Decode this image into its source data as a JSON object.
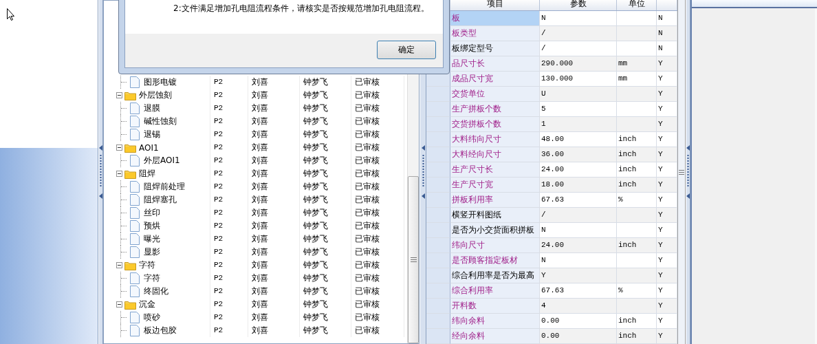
{
  "dialog": {
    "message": "2:文件满足增加孔电阻流程条件，请核实是否按规范增加孔电阻流程。",
    "button": "确定"
  },
  "tree": {
    "nodes": [
      {
        "kind": "file",
        "label": "图形电镀",
        "values": [
          "P2",
          "刘喜",
          "钟梦飞",
          "已审核"
        ]
      },
      {
        "kind": "folder",
        "label": "外层蚀刻",
        "expanded": true,
        "values": [
          "P2",
          "刘喜",
          "钟梦飞",
          "已审核"
        ],
        "children": [
          {
            "kind": "file",
            "label": "退膜",
            "values": [
              "P2",
              "刘喜",
              "钟梦飞",
              "已审核"
            ]
          },
          {
            "kind": "file",
            "label": "碱性蚀刻",
            "values": [
              "P2",
              "刘喜",
              "钟梦飞",
              "已审核"
            ]
          },
          {
            "kind": "file",
            "label": "退锡",
            "values": [
              "P2",
              "刘喜",
              "钟梦飞",
              "已审核"
            ]
          }
        ]
      },
      {
        "kind": "folder",
        "label": "AOI1",
        "expanded": true,
        "values": [
          "P2",
          "刘喜",
          "钟梦飞",
          "已审核"
        ],
        "children": [
          {
            "kind": "file",
            "label": "外层AOI1",
            "values": [
              "P2",
              "刘喜",
              "钟梦飞",
              "已审核"
            ]
          }
        ]
      },
      {
        "kind": "folder",
        "label": "阻焊",
        "expanded": true,
        "values": [
          "P2",
          "刘喜",
          "钟梦飞",
          "已审核"
        ],
        "children": [
          {
            "kind": "file",
            "label": "阻焊前处理",
            "values": [
              "P2",
              "刘喜",
              "钟梦飞",
              "已审核"
            ]
          },
          {
            "kind": "file",
            "label": "阻焊塞孔",
            "values": [
              "P2",
              "刘喜",
              "钟梦飞",
              "已审核"
            ]
          },
          {
            "kind": "file",
            "label": "丝印",
            "values": [
              "P2",
              "刘喜",
              "钟梦飞",
              "已审核"
            ]
          },
          {
            "kind": "file",
            "label": "预烘",
            "values": [
              "P2",
              "刘喜",
              "钟梦飞",
              "已审核"
            ]
          },
          {
            "kind": "file",
            "label": "曝光",
            "values": [
              "P2",
              "刘喜",
              "钟梦飞",
              "已审核"
            ]
          },
          {
            "kind": "file",
            "label": "显影",
            "values": [
              "P2",
              "刘喜",
              "钟梦飞",
              "已审核"
            ]
          }
        ]
      },
      {
        "kind": "folder",
        "label": "字符",
        "expanded": true,
        "values": [
          "P2",
          "刘喜",
          "钟梦飞",
          "已审核"
        ],
        "children": [
          {
            "kind": "file",
            "label": "字符",
            "values": [
              "P2",
              "刘喜",
              "钟梦飞",
              "已审核"
            ]
          },
          {
            "kind": "file",
            "label": "终固化",
            "values": [
              "P2",
              "刘喜",
              "钟梦飞",
              "已审核"
            ]
          }
        ]
      },
      {
        "kind": "folder",
        "label": "沉金",
        "expanded": true,
        "values": [
          "P2",
          "刘喜",
          "钟梦飞",
          "已审核"
        ],
        "children": [
          {
            "kind": "file",
            "label": "喷砂",
            "values": [
              "P2",
              "刘喜",
              "钟梦飞",
              "已审核"
            ]
          },
          {
            "kind": "file",
            "label": "板边包胶",
            "values": [
              "P2",
              "刘喜",
              "钟梦飞",
              "已审核"
            ]
          }
        ]
      }
    ]
  },
  "params": {
    "columns": [
      "项目",
      "参数",
      "单位"
    ],
    "rows": [
      {
        "item": "板",
        "value": "N",
        "unit": "",
        "flag": "N",
        "kind": "marked",
        "selected": true
      },
      {
        "item": "板类型",
        "value": "/",
        "unit": "",
        "flag": "N",
        "kind": "marked",
        "selected": false
      },
      {
        "item": "板绑定型号",
        "value": "/",
        "unit": "",
        "flag": "N",
        "kind": "plain",
        "selected": false
      },
      {
        "item": "品尺寸长",
        "value": "290.000",
        "unit": "mm",
        "flag": "Y",
        "kind": "marked",
        "selected": false
      },
      {
        "item": "成品尺寸宽",
        "value": "130.000",
        "unit": "mm",
        "flag": "Y",
        "kind": "marked",
        "selected": false
      },
      {
        "item": "交货单位",
        "value": "U",
        "unit": "",
        "flag": "Y",
        "kind": "marked",
        "selected": false
      },
      {
        "item": "生产拼板个数",
        "value": "5",
        "unit": "",
        "flag": "Y",
        "kind": "marked",
        "selected": false
      },
      {
        "item": "交货拼板个数",
        "value": "1",
        "unit": "",
        "flag": "Y",
        "kind": "marked",
        "selected": false
      },
      {
        "item": "大料纬向尺寸",
        "value": "48.00",
        "unit": "inch",
        "flag": "Y",
        "kind": "marked",
        "selected": false
      },
      {
        "item": "大料经向尺寸",
        "value": "36.00",
        "unit": "inch",
        "flag": "Y",
        "kind": "marked",
        "selected": false
      },
      {
        "item": "生产尺寸长",
        "value": "24.00",
        "unit": "inch",
        "flag": "Y",
        "kind": "marked",
        "selected": false
      },
      {
        "item": "生产尺寸宽",
        "value": "18.00",
        "unit": "inch",
        "flag": "Y",
        "kind": "marked",
        "selected": false
      },
      {
        "item": "拼板利用率",
        "value": "67.63",
        "unit": "%",
        "flag": "Y",
        "kind": "marked",
        "selected": false
      },
      {
        "item": "横竖开料图纸",
        "value": "/",
        "unit": "",
        "flag": "Y",
        "kind": "plain",
        "selected": false
      },
      {
        "item": "是否为小交货面积拼板",
        "value": "N",
        "unit": "",
        "flag": "Y",
        "kind": "plain",
        "selected": false
      },
      {
        "item": "纬向尺寸",
        "value": "24.00",
        "unit": "inch",
        "flag": "Y",
        "kind": "marked",
        "selected": false
      },
      {
        "item": "是否顾客指定板材",
        "value": "N",
        "unit": "",
        "flag": "Y",
        "kind": "marked",
        "selected": false
      },
      {
        "item": "综合利用率是否为最高",
        "value": "Y",
        "unit": "",
        "flag": "Y",
        "kind": "plain",
        "selected": false
      },
      {
        "item": "综合利用率",
        "value": "67.63",
        "unit": "%",
        "flag": "Y",
        "kind": "marked",
        "selected": false
      },
      {
        "item": "开料数",
        "value": "4",
        "unit": "",
        "flag": "Y",
        "kind": "marked",
        "selected": false
      },
      {
        "item": "纬向余料",
        "value": "0.00",
        "unit": "inch",
        "flag": "Y",
        "kind": "marked",
        "selected": false
      },
      {
        "item": "经向余料",
        "value": "0.00",
        "unit": "inch",
        "flag": "Y",
        "kind": "marked",
        "selected": false
      }
    ]
  }
}
